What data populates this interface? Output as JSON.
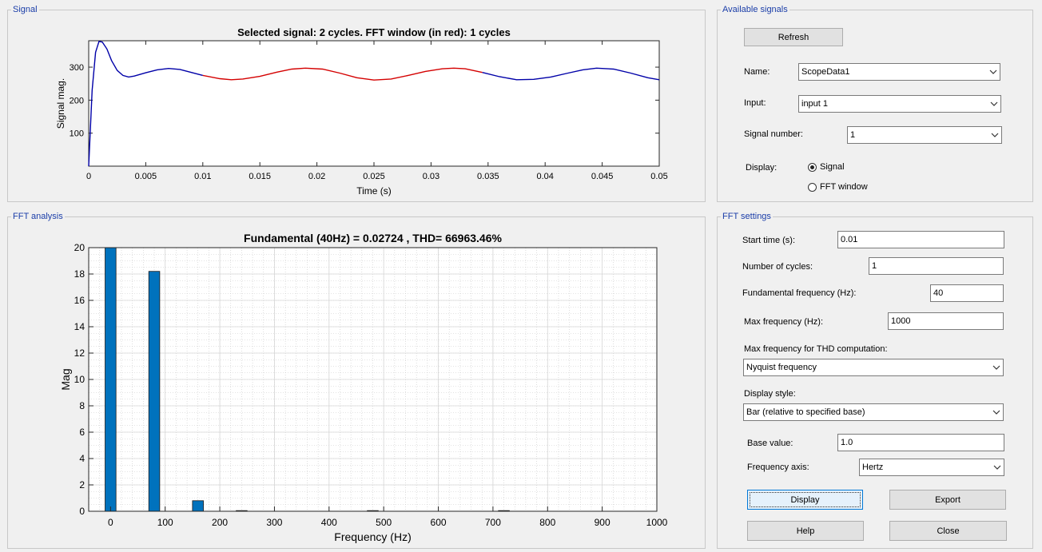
{
  "signal_panel": {
    "title": "Signal",
    "chart_title": "Selected signal: 2 cycles. FFT window (in red): 1 cycles",
    "xlabel": "Time (s)",
    "ylabel": "Signal mag."
  },
  "fft_panel": {
    "title": "FFT analysis",
    "chart_title": "Fundamental (40Hz) = 0.02724 , THD= 66963.46%",
    "xlabel": "Frequency (Hz)",
    "ylabel": "Mag"
  },
  "available_signals": {
    "title": "Available signals",
    "refresh_label": "Refresh",
    "name_label": "Name:",
    "name_value": "ScopeData1",
    "input_label": "Input:",
    "input_value": "input 1",
    "signal_number_label": "Signal number:",
    "signal_number_value": "1",
    "display_label": "Display:",
    "display_options": [
      "Signal",
      "FFT window"
    ],
    "display_selected": "Signal"
  },
  "fft_settings": {
    "title": "FFT settings",
    "start_time_label": "Start time (s):",
    "start_time_value": "0.01",
    "cycles_label": "Number of cycles:",
    "cycles_value": "1",
    "fund_freq_label": "Fundamental frequency (Hz):",
    "fund_freq_value": "40",
    "max_freq_label": "Max frequency (Hz):",
    "max_freq_value": "1000",
    "thd_label": "Max frequency for THD computation:",
    "thd_value": "Nyquist frequency",
    "display_style_label": "Display style:",
    "display_style_value": "Bar (relative to specified base)",
    "base_value_label": "Base value:",
    "base_value_value": "1.0",
    "freq_axis_label": "Frequency axis:",
    "freq_axis_value": "Hertz",
    "display_button": "Display",
    "export_button": "Export",
    "help_button": "Help",
    "close_button": "Close"
  },
  "chart_data": [
    {
      "type": "line",
      "title": "Selected signal: 2 cycles. FFT window (in red): 1 cycles",
      "xlabel": "Time (s)",
      "ylabel": "Signal mag.",
      "xlim": [
        0,
        0.05
      ],
      "ylim": [
        0,
        380
      ],
      "x_ticks": [
        0,
        0.005,
        0.01,
        0.015,
        0.02,
        0.025,
        0.03,
        0.035,
        0.04,
        0.045,
        0.05
      ],
      "x_tick_labels": [
        "0",
        "0.005",
        "0.01",
        "0.015",
        "0.02",
        "0.025",
        "0.03",
        "0.035",
        "0.04",
        "0.045",
        "0.05"
      ],
      "y_ticks": [
        100,
        200,
        300
      ],
      "y_tick_labels": [
        "100",
        "200",
        "300"
      ],
      "series": [
        {
          "color": "#0000a8",
          "x": [
            0,
            0.0003,
            0.0006,
            0.0009,
            0.0012,
            0.0016,
            0.002,
            0.0025,
            0.003,
            0.0035,
            0.004,
            0.005,
            0.006,
            0.007,
            0.008,
            0.009,
            0.01
          ],
          "y": [
            0,
            230,
            345,
            378,
            376,
            355,
            320,
            290,
            275,
            270,
            273,
            283,
            292,
            296,
            293,
            284,
            275
          ]
        },
        {
          "color": "#d40000",
          "x": [
            0.01,
            0.0115,
            0.0125,
            0.0135,
            0.015,
            0.0165,
            0.0178,
            0.019,
            0.0205,
            0.022,
            0.0235,
            0.025,
            0.0265,
            0.028,
            0.0295,
            0.031,
            0.032,
            0.033,
            0.0345
          ],
          "y": [
            275,
            265,
            262,
            264,
            272,
            285,
            294,
            297,
            294,
            282,
            268,
            261,
            264,
            275,
            287,
            295,
            297,
            295,
            284
          ]
        },
        {
          "color": "#0000a8",
          "x": [
            0.0345,
            0.036,
            0.0375,
            0.039,
            0.0405,
            0.042,
            0.0433,
            0.0445,
            0.046,
            0.0475,
            0.049,
            0.05
          ],
          "y": [
            284,
            271,
            262,
            263,
            270,
            282,
            292,
            297,
            294,
            282,
            268,
            262
          ]
        }
      ]
    },
    {
      "type": "bar",
      "title": "Fundamental (40Hz) = 0.02724 , THD= 66963.46%",
      "xlabel": "Frequency (Hz)",
      "ylabel": "Mag",
      "xlim": [
        -40,
        1000
      ],
      "ylim": [
        0,
        20
      ],
      "x_ticks": [
        0,
        100,
        200,
        300,
        400,
        500,
        600,
        700,
        800,
        900,
        1000
      ],
      "x_tick_labels": [
        "0",
        "100",
        "200",
        "300",
        "400",
        "500",
        "600",
        "700",
        "800",
        "900",
        "1000"
      ],
      "y_ticks": [
        0,
        2,
        4,
        6,
        8,
        10,
        12,
        14,
        16,
        18,
        20
      ],
      "y_tick_labels": [
        "0",
        "2",
        "4",
        "6",
        "8",
        "10",
        "12",
        "14",
        "16",
        "18",
        "20"
      ],
      "bar_color": "#0072bd",
      "bar_width": 20,
      "x": [
        0,
        80,
        160,
        240,
        480,
        720
      ],
      "values": [
        20,
        18.2,
        0.8,
        0.05,
        0.05,
        0.05
      ],
      "grid": true
    }
  ]
}
